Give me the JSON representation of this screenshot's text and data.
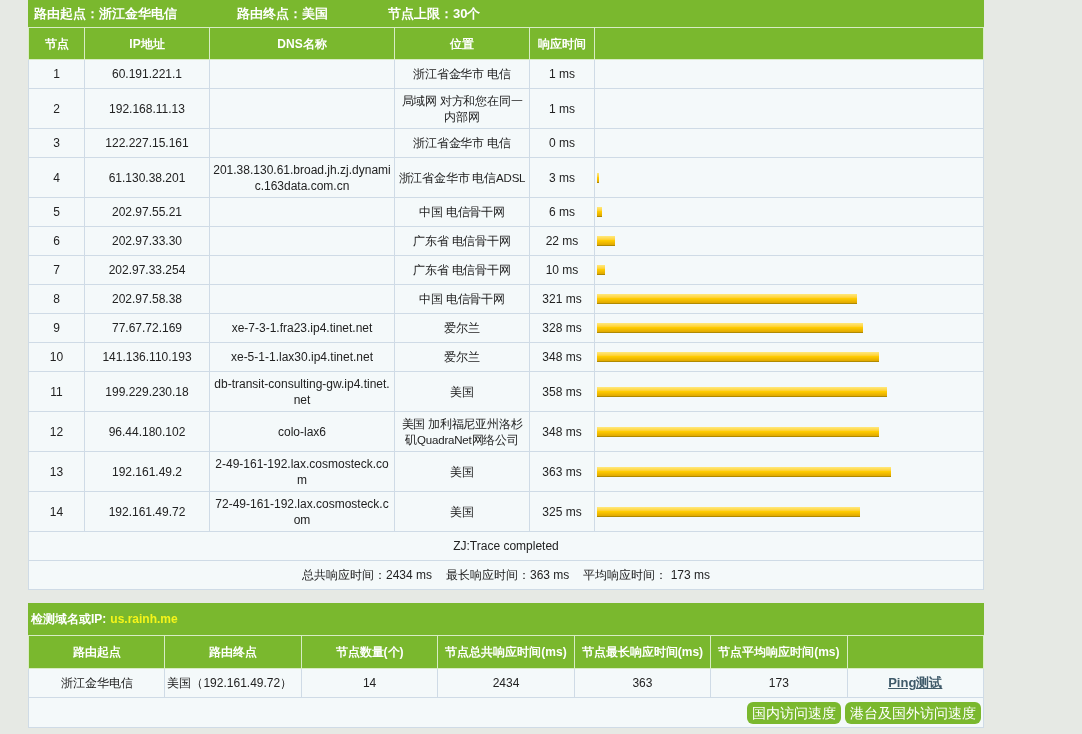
{
  "route_header": [
    "路由起点：浙江金华电信",
    "路由终点：美国",
    "节点上限：30个"
  ],
  "trace_table": {
    "columns": [
      "节点",
      "IP地址",
      "DNS名称",
      "位置",
      "响应时间"
    ],
    "rows": [
      {
        "node": "1",
        "ip": "60.191.221.1",
        "dns": "",
        "location": "浙江省金华市 电信",
        "time": "1 ms"
      },
      {
        "node": "2",
        "ip": "192.168.11.13",
        "dns": "",
        "location": "局域网 对方和您在同一内部网",
        "time": "1 ms"
      },
      {
        "node": "3",
        "ip": "122.227.15.161",
        "dns": "",
        "location": "浙江省金华市 电信",
        "time": "0 ms"
      },
      {
        "node": "4",
        "ip": "61.130.38.201",
        "dns": "201.38.130.61.broad.jh.zj.dynamic.163data.com.cn",
        "location": "浙江省金华市 电信ADSL",
        "time": "3 ms",
        "level": 0.006
      },
      {
        "node": "5",
        "ip": "202.97.55.21",
        "dns": "",
        "location": "中国 电信骨干网",
        "time": "6 ms",
        "level": 0.013
      },
      {
        "node": "6",
        "ip": "202.97.33.30",
        "dns": "",
        "location": "广东省 电信骨干网",
        "time": "22 ms",
        "level": 0.047
      },
      {
        "node": "7",
        "ip": "202.97.33.254",
        "dns": "",
        "location": "广东省 电信骨干网",
        "time": "10 ms",
        "level": 0.022
      },
      {
        "node": "8",
        "ip": "202.97.58.38",
        "dns": "",
        "location": "中国 电信骨干网",
        "time": "321 ms",
        "level": 0.685
      },
      {
        "node": "9",
        "ip": "77.67.72.169",
        "dns": "xe-7-3-1.fra23.ip4.tinet.net",
        "location": "爱尔兰",
        "time": "328 ms",
        "level": 0.7
      },
      {
        "node": "10",
        "ip": "141.136.110.193",
        "dns": "xe-5-1-1.lax30.ip4.tinet.net",
        "location": "爱尔兰",
        "time": "348 ms",
        "level": 0.742
      },
      {
        "node": "11",
        "ip": "199.229.230.18",
        "dns": "db-transit-consulting-gw.ip4.tinet.net",
        "location": "美国",
        "time": "358 ms",
        "level": 0.763
      },
      {
        "node": "12",
        "ip": "96.44.180.102",
        "dns": "colo-lax6",
        "location": "美国 加利福尼亚州洛杉矶QuadraNet网络公司",
        "time": "348 ms",
        "level": 0.742
      },
      {
        "node": "13",
        "ip": "192.161.49.2",
        "dns": "2-49-161-192.lax.cosmosteck.com",
        "location": "美国",
        "time": "363 ms",
        "level": 0.774
      },
      {
        "node": "14",
        "ip": "192.161.49.72",
        "dns": "72-49-161-192.lax.cosmosteck.com",
        "location": "美国",
        "time": "325 ms",
        "level": 0.693
      }
    ],
    "status": "ZJ:Trace completed",
    "summary": [
      "总共响应时间：2434 ms",
      "最长响应时间：363 ms",
      "平均响应时间： 173 ms"
    ]
  },
  "summary_table": {
    "label": "检测域名或IP:",
    "target": "us.rainh.me",
    "columns": [
      "路由起点",
      "路由终点",
      "节点数量(个)",
      "节点总共响应时间(ms)",
      "节点最长响应时间(ms)",
      "节点平均响应时间(ms)"
    ],
    "row": [
      "浙江金华电信",
      "美国（192.161.49.72）",
      "14",
      "2434",
      "363",
      "173"
    ],
    "link": "Ping测试",
    "buttons": [
      "国内访问速度",
      "港台及国外访问速度"
    ]
  }
}
